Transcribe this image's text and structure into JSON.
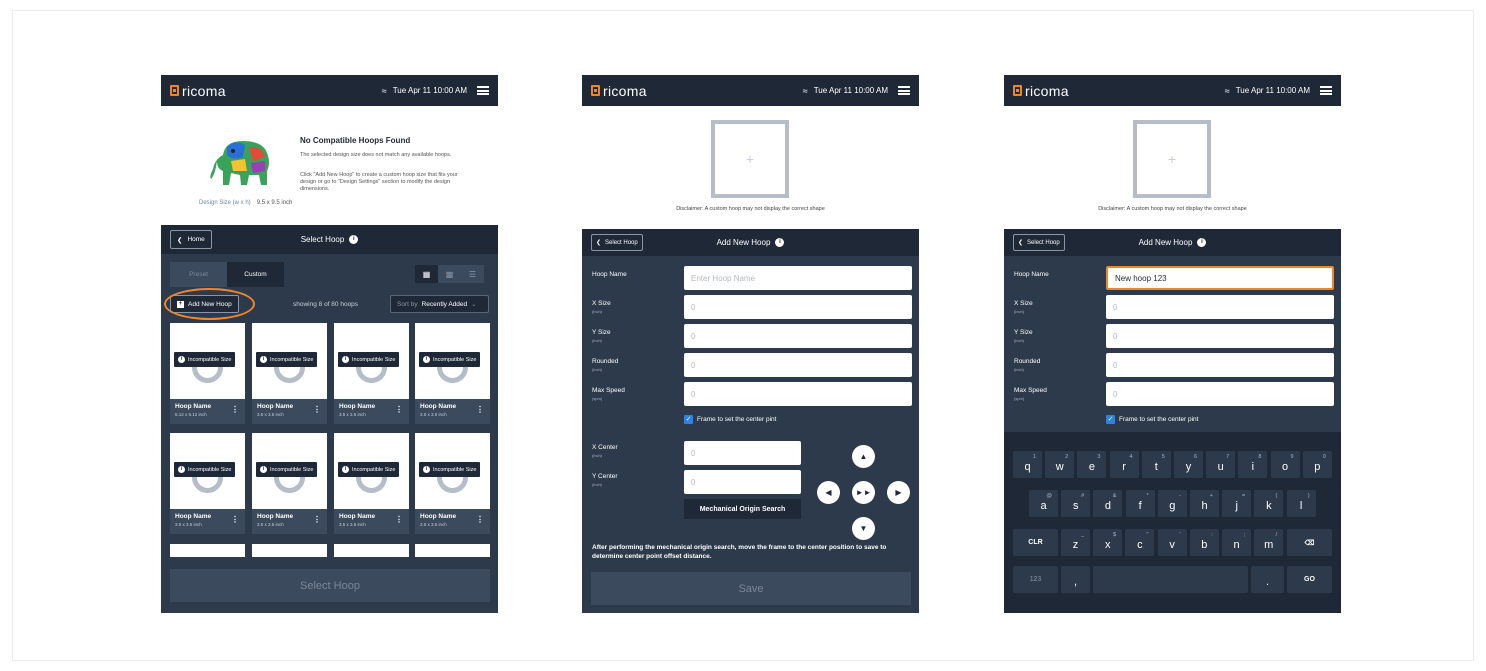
{
  "status": {
    "time": "Tue Apr 11  10:00 AM"
  },
  "brand": "ricoma",
  "s1": {
    "design_size_label": "Design Size (w x h)",
    "design_size_value": "9.5 x 9.5 inch",
    "title": "No Compatible Hoops Found",
    "p1": "The selected design size does not match any available hoops.",
    "p2": "Click \"Add New Hoop\" to create a custom hoop size that fits your design or go to \"Design Settings\" section to modify the design dimensions.",
    "home": "Home",
    "header": "Select Hoop",
    "tabs": [
      "Preset",
      "Custom"
    ],
    "add": "Add New Hoop",
    "showing": "showing 8 of 80 hoops",
    "sort_label": "Sort by",
    "sort_value": "Recently Added",
    "badge": "Incompatible Size",
    "cards": [
      {
        "name": "Hoop Name",
        "size": "5.12 x 5.12 inch"
      },
      {
        "name": "Hoop Name",
        "size": "3.5 x 3.5 inch"
      },
      {
        "name": "Hoop Name",
        "size": "3.5 x 3.5 inch"
      },
      {
        "name": "Hoop Name",
        "size": "3.5 x 3.5 inch"
      },
      {
        "name": "Hoop Name",
        "size": "3.5 x 3.5 inch"
      },
      {
        "name": "Hoop Name",
        "size": "3.5 x 3.5 inch"
      },
      {
        "name": "Hoop Name",
        "size": "3.5 x 3.5 inch"
      },
      {
        "name": "Hoop Name",
        "size": "3.5 x 3.5 inch"
      }
    ],
    "select": "Select Hoop"
  },
  "form": {
    "disclaimer": "Disclaimer: A custom hoop may not display the correct shape",
    "back": "Select Hoop",
    "title": "Add New Hoop",
    "fields": [
      {
        "label": "Hoop Name",
        "unit": "",
        "placeholder": "Enter Hoop Name"
      },
      {
        "label": "X Size",
        "unit": "(inch)",
        "placeholder": "0"
      },
      {
        "label": "Y Size",
        "unit": "(inch)",
        "placeholder": "0"
      },
      {
        "label": "Rounded",
        "unit": "(inch)",
        "placeholder": "0"
      },
      {
        "label": "Max Speed",
        "unit": "(spm)",
        "placeholder": "0"
      }
    ],
    "checkbox": "Frame to set the center pint",
    "x_center": "X Center",
    "y_center": "Y Center",
    "unit": "(inch)",
    "zero": "0",
    "mos": "Mechanical Origin Search",
    "note": "After performing the mechanical origin search, move the frame to the center position to save to determine center point offset distance.",
    "save": "Save",
    "filled_name": "New hoop 123"
  },
  "keyboard": {
    "row1": [
      {
        "k": "q",
        "s": "1"
      },
      {
        "k": "w",
        "s": "2"
      },
      {
        "k": "e",
        "s": "3"
      },
      {
        "k": "r",
        "s": "4"
      },
      {
        "k": "t",
        "s": "5"
      },
      {
        "k": "y",
        "s": "6"
      },
      {
        "k": "u",
        "s": "7"
      },
      {
        "k": "i",
        "s": "8"
      },
      {
        "k": "o",
        "s": "9"
      },
      {
        "k": "p",
        "s": "0"
      }
    ],
    "row2": [
      {
        "k": "a",
        "s": "@"
      },
      {
        "k": "s",
        "s": "#"
      },
      {
        "k": "d",
        "s": "&"
      },
      {
        "k": "f",
        "s": "*"
      },
      {
        "k": "g",
        "s": "-"
      },
      {
        "k": "h",
        "s": "+"
      },
      {
        "k": "j",
        "s": "="
      },
      {
        "k": "k",
        "s": "("
      },
      {
        "k": "l",
        "s": ")"
      }
    ],
    "row3": [
      {
        "k": "z",
        "s": "_"
      },
      {
        "k": "x",
        "s": "$"
      },
      {
        "k": "c",
        "s": "\""
      },
      {
        "k": "v",
        "s": "'"
      },
      {
        "k": "b",
        "s": ":"
      },
      {
        "k": "n",
        "s": ";"
      },
      {
        "k": "m",
        "s": "/"
      }
    ],
    "clr": "CLR",
    "num": "123",
    "comma": ",",
    "period": ".",
    "go": "GO"
  },
  "colors": {
    "accent": "#f0862b",
    "dark": "#1e2837",
    "panel": "#2d3a4b",
    "check": "#2b83e8"
  }
}
